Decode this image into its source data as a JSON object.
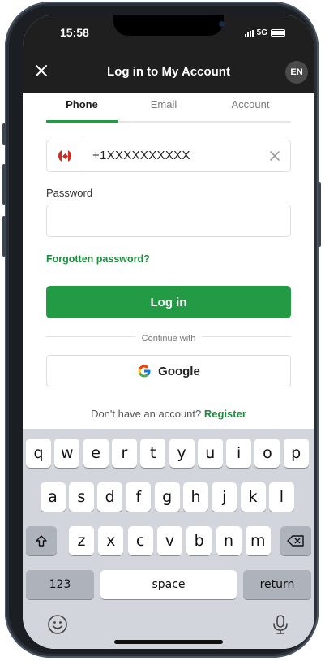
{
  "status_bar": {
    "time": "15:58",
    "network": "5G"
  },
  "header": {
    "title": "Log in to My Account",
    "language": "EN"
  },
  "tabs": [
    {
      "label": "Phone",
      "active": true
    },
    {
      "label": "Email",
      "active": false
    },
    {
      "label": "Account",
      "active": false
    }
  ],
  "phone_field": {
    "country_flag": "canada-flag-icon",
    "value": "+1XXXXXXXXXX"
  },
  "password": {
    "label": "Password",
    "value": ""
  },
  "forgot_link": "Forgotten password?",
  "login_button": "Log in",
  "continue_with": "Continue with",
  "google_button": "Google",
  "register": {
    "prompt": "Don't have an account?",
    "link": "Register"
  },
  "keyboard": {
    "row1": [
      "q",
      "w",
      "e",
      "r",
      "t",
      "y",
      "u",
      "i",
      "o",
      "p"
    ],
    "row2": [
      "a",
      "s",
      "d",
      "f",
      "g",
      "h",
      "j",
      "k",
      "l"
    ],
    "row3": [
      "z",
      "x",
      "c",
      "v",
      "b",
      "n",
      "m"
    ],
    "numbers_key": "123",
    "space_key": "space",
    "return_key": "return"
  },
  "colors": {
    "accent": "#239b45",
    "header_bg": "#1f1f1f",
    "keyboard_bg": "#d2d5db"
  }
}
